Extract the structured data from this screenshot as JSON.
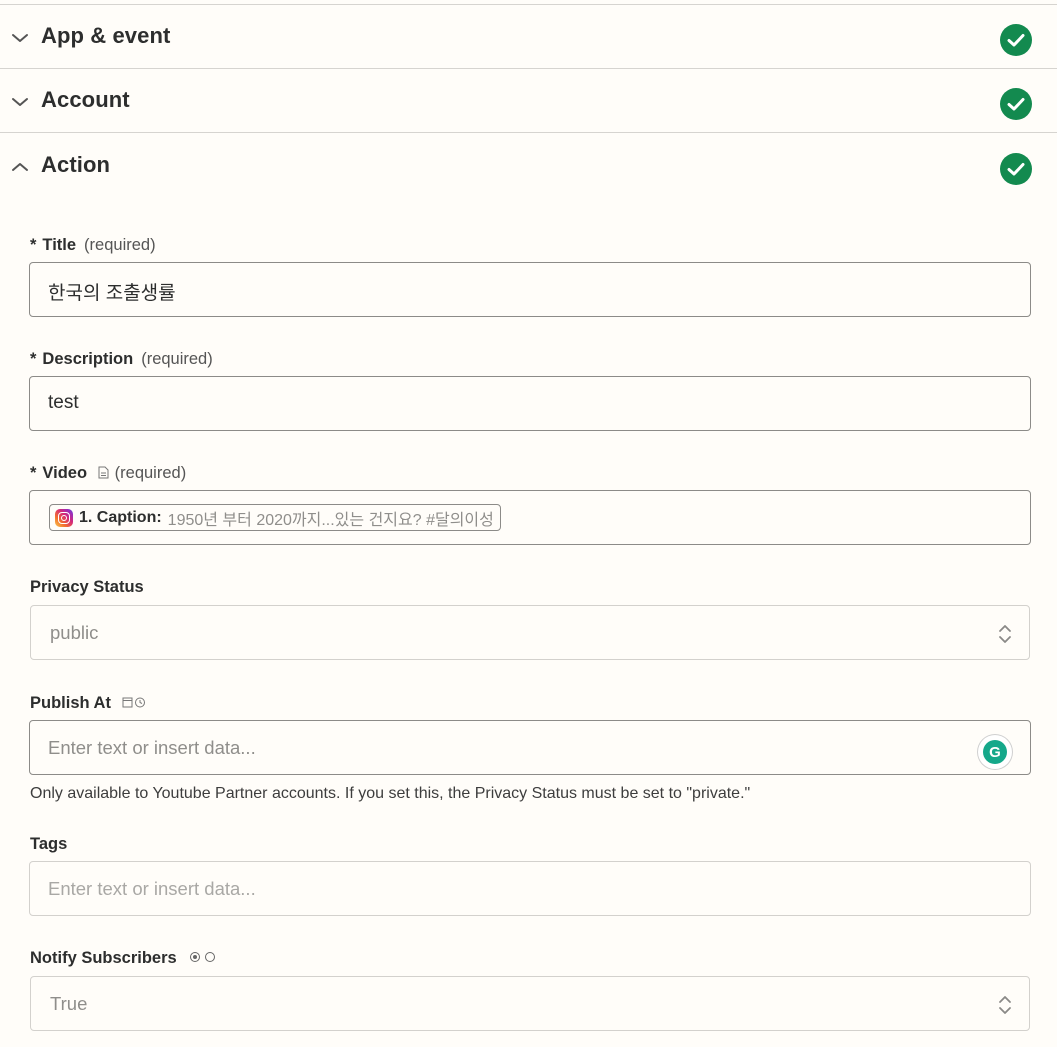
{
  "sections": {
    "app_event": {
      "title": "App & event"
    },
    "account": {
      "title": "Account"
    },
    "action": {
      "title": "Action"
    }
  },
  "colors": {
    "accent_check": "#138a4f",
    "field_border": "#8c8b88",
    "background": "#fffdf9"
  },
  "fields": {
    "title": {
      "star": "*",
      "label": "Title",
      "req": "(required)",
      "value": "한국의 조출생률"
    },
    "description": {
      "star": "*",
      "label": "Description",
      "req": "(required)",
      "value": "test"
    },
    "video": {
      "star": "*",
      "label": "Video",
      "req": "(required)",
      "icon": "document-icon",
      "pill_label": "1. Caption:",
      "pill_value": "1950년 부터 2020까지...있는 건지요?  #달의이성"
    },
    "privacy": {
      "label": "Privacy Status",
      "value": "public"
    },
    "publish_at": {
      "label": "Publish At",
      "icon": "calendar-clock-icon",
      "placeholder": "Enter text or insert data...",
      "help": "Only available to Youtube Partner accounts. If you set this, the Privacy Status must be set to \"private.\""
    },
    "tags": {
      "label": "Tags",
      "placeholder": "Enter text or insert data..."
    },
    "notify": {
      "label": "Notify Subscribers",
      "icon": "radio-icon",
      "value": "True"
    }
  },
  "grammarly": {
    "letter": "G"
  }
}
